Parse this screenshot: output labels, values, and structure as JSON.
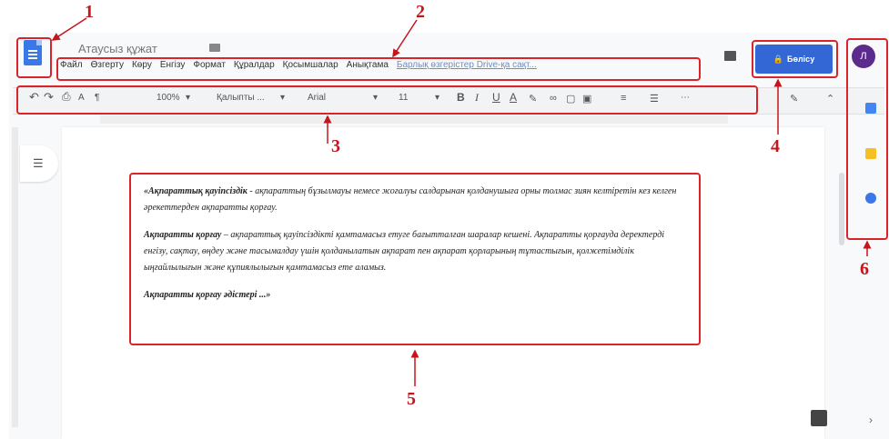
{
  "window": {
    "title": "Атаусыз құжат"
  },
  "menu": {
    "items": [
      "Файл",
      "Өзгерту",
      "Көру",
      "Енгізу",
      "Формат",
      "Құралдар",
      "Қосымшалар",
      "Анықтама"
    ],
    "link": "Барлық өзгерістер Drive-қа сақт..."
  },
  "toolbar": {
    "zoom": "100%",
    "style": "Қалыпты ...",
    "font": "Arial",
    "font_size": "11",
    "bold": "B",
    "italic": "I",
    "underline": "U",
    "text_color": "A",
    "more": "⋯"
  },
  "share_button": {
    "label": "Бөлісу"
  },
  "avatar": {
    "initial": "Л"
  },
  "document": {
    "p1_bold": "«Ақпараттық қауіпсіздік",
    "p1_rest": " - ақпараттың бұзылмауы немесе жоғалуы салдарынан қолданушыға орны толмас зиян келтіретін кез келген әрекеттерден ақпаратты қорғау.",
    "p2_bold": "Ақпаратты қорғау",
    "p2_rest": " – ақпараттық қауіпсіздікті қамтамасыз етуге бағытталған шаралар кешені. Ақпаратты қорғауда деректерді енгізу, сақтау, өңдеу және тасымалдау үшін қолданылатын ақпарат пен ақпарат қорларының тұтастығын, қолжетімділік ыңғайлылығын және құпиялылығын қамтамасыз ете аламыз.",
    "p3_bold": "Ақпаратты қорғау әдістері ...»"
  },
  "callouts": [
    "1",
    "2",
    "3",
    "4",
    "5",
    "6"
  ],
  "colors": {
    "accent_red": "#c4161c",
    "share_blue": "#3367d6",
    "doc_blue": "#3b78e7"
  }
}
